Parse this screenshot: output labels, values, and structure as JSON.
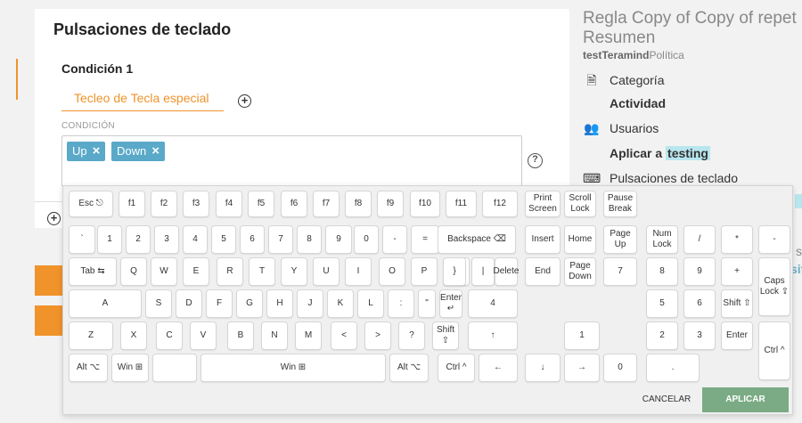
{
  "card": {
    "title": "Pulsaciones de teclado",
    "condition_title": "Condición 1",
    "condition_type": "Tecleo de Tecla especial",
    "condition_label": "CONDICIÓN",
    "tags": [
      "Up",
      "Down"
    ],
    "help": "?",
    "add": "+"
  },
  "side": {
    "title": "Regla Copy of Copy of repet",
    "subtitle": "Resumen",
    "org": "testTeramind",
    "org_suffix": "Política",
    "category_label": "Categoría",
    "category_value": "Actividad",
    "users_label": "Usuarios",
    "apply_prefix": "Aplicar a",
    "apply_value": "testing",
    "keystrokes_label": "Pulsaciones de teclado",
    "edge_text1": "s",
    "edge_text2": "sif",
    "icons": [
      "document-icon",
      "users-icon",
      "keyboard-icon"
    ]
  },
  "keyboard": {
    "keys": [
      "Esc ⎋",
      "f1",
      "f2",
      "f3",
      "f4",
      "f5",
      "f6",
      "f7",
      "f8",
      "f9",
      "f10",
      "f11",
      "f12",
      "Print\nScreen",
      "Scroll\nLock",
      "Pause\nBreak",
      "`",
      "1",
      "2",
      "3",
      "4",
      "5",
      "6",
      "7",
      "8",
      "9",
      "0",
      "-",
      "=",
      "Backspace ⌫",
      "Insert",
      "Home",
      "Page\nUp",
      "Num\nLock",
      "/",
      "*",
      "-",
      "Tab ⇆",
      "Q",
      "W",
      "E",
      "R",
      "T",
      "Y",
      "U",
      "I",
      "O",
      "P",
      "{",
      "}",
      "|",
      "Delete",
      "End",
      "Page\nDown",
      "7",
      "8",
      "9",
      "+",
      "Caps Lock ⇪",
      "A",
      "S",
      "D",
      "F",
      "G",
      "H",
      "J",
      "K",
      "L",
      ":",
      "\"",
      "Enter ↵",
      "4",
      "5",
      "6",
      "Shift ⇧",
      "Z",
      "X",
      "C",
      "V",
      "B",
      "N",
      "M",
      "<",
      ">",
      "?",
      "Shift ⇧",
      "↑",
      "1",
      "2",
      "3",
      "Enter",
      "Ctrl ^",
      "Alt ⌥",
      "Win ⊞",
      "",
      "Win ⊞",
      "Alt ⌥",
      "Ctrl ^",
      "←",
      "↓",
      "→",
      "0",
      "."
    ],
    "cancel": "CANCELAR",
    "apply": "APLICAR"
  },
  "colors": {
    "accent": "#f0932b",
    "tag": "#5aa9c8",
    "highlight": "#b8e6ee",
    "apply": "#7aab84"
  }
}
